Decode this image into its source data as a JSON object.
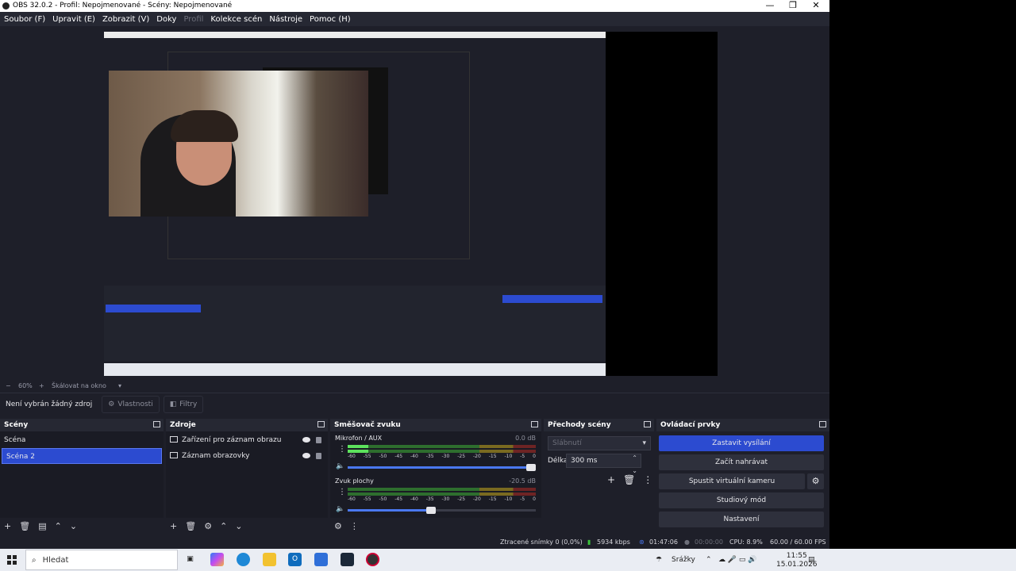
{
  "window": {
    "title": "OBS 32.0.2 - Profil: Nepojmenované - Scény: Nepojmenované",
    "minimize": "—",
    "maximize": "❐",
    "close": "✕"
  },
  "menu": [
    {
      "label": "Soubor (F)",
      "enabled": true
    },
    {
      "label": "Upravit (E)",
      "enabled": true
    },
    {
      "label": "Zobrazit (V)",
      "enabled": true
    },
    {
      "label": "Doky",
      "enabled": true
    },
    {
      "label": "Profil",
      "enabled": false
    },
    {
      "label": "Kolekce scén",
      "enabled": true
    },
    {
      "label": "Nástroje",
      "enabled": true
    },
    {
      "label": "Pomoc (H)",
      "enabled": true
    }
  ],
  "previewbar": {
    "minus": "−",
    "zoom": "60%",
    "plus": "+",
    "scale_mode": "Škálovat na okno",
    "dropdown": "▾"
  },
  "context": {
    "no_selection": "Není vybrán žádný zdroj",
    "properties": "Vlastnosti",
    "filters": "Filtry"
  },
  "scenes": {
    "title": "Scény",
    "items": [
      {
        "label": "Scéna",
        "selected": false
      },
      {
        "label": "Scéna 2",
        "selected": true
      }
    ],
    "tools": [
      "+",
      "🗑",
      "▤",
      "⌃",
      "⌄"
    ]
  },
  "sources": {
    "title": "Zdroje",
    "items": [
      {
        "label": "Zařízení pro záznam obrazu",
        "icon": "camera-icon"
      },
      {
        "label": "Záznam obrazovky",
        "icon": "monitor-icon"
      }
    ],
    "tools": [
      "+",
      "🗑",
      "⚙",
      "⌃",
      "⌄"
    ]
  },
  "mixer": {
    "title": "Směšovač zvuku",
    "scale": [
      "-60",
      "-55",
      "-50",
      "-45",
      "-40",
      "-35",
      "-30",
      "-25",
      "-20",
      "-15",
      "-10",
      "-5",
      "0"
    ],
    "tracks": [
      {
        "name": "Mikrofon / AUX",
        "db": "0.0 dB",
        "level": 0.11,
        "volume": 1.0
      },
      {
        "name": "Zvuk plochy",
        "db": "-20.5 dB",
        "level": 0.0,
        "volume": 0.47
      }
    ]
  },
  "transitions": {
    "title": "Přechody scény",
    "selected": "Slábnutí",
    "duration_label": "Délka",
    "duration": "300 ms"
  },
  "controls": {
    "title": "Ovládací prvky",
    "stop_streaming": "Zastavit vysílání",
    "start_recording": "Začít nahrávat",
    "virtual_camera": "Spustit virtuální kameru",
    "studio_mode": "Studiový mód",
    "settings": "Nastavení"
  },
  "status": {
    "dropped": "Ztracené snímky 0 (0,0%)",
    "bitrate": "5934 kbps",
    "stream_time": "01:47:06",
    "rec_time": "00:00:00",
    "cpu": "CPU: 8.9%",
    "fps": "60.00 / 60.00 FPS"
  },
  "taskbar": {
    "search": "Hledat",
    "weather": "Srážky",
    "time": "11:55",
    "date": "15.01.2026"
  },
  "colors": {
    "accent": "#2c4bd0",
    "panel": "#1e1f29",
    "header": "#262833"
  }
}
